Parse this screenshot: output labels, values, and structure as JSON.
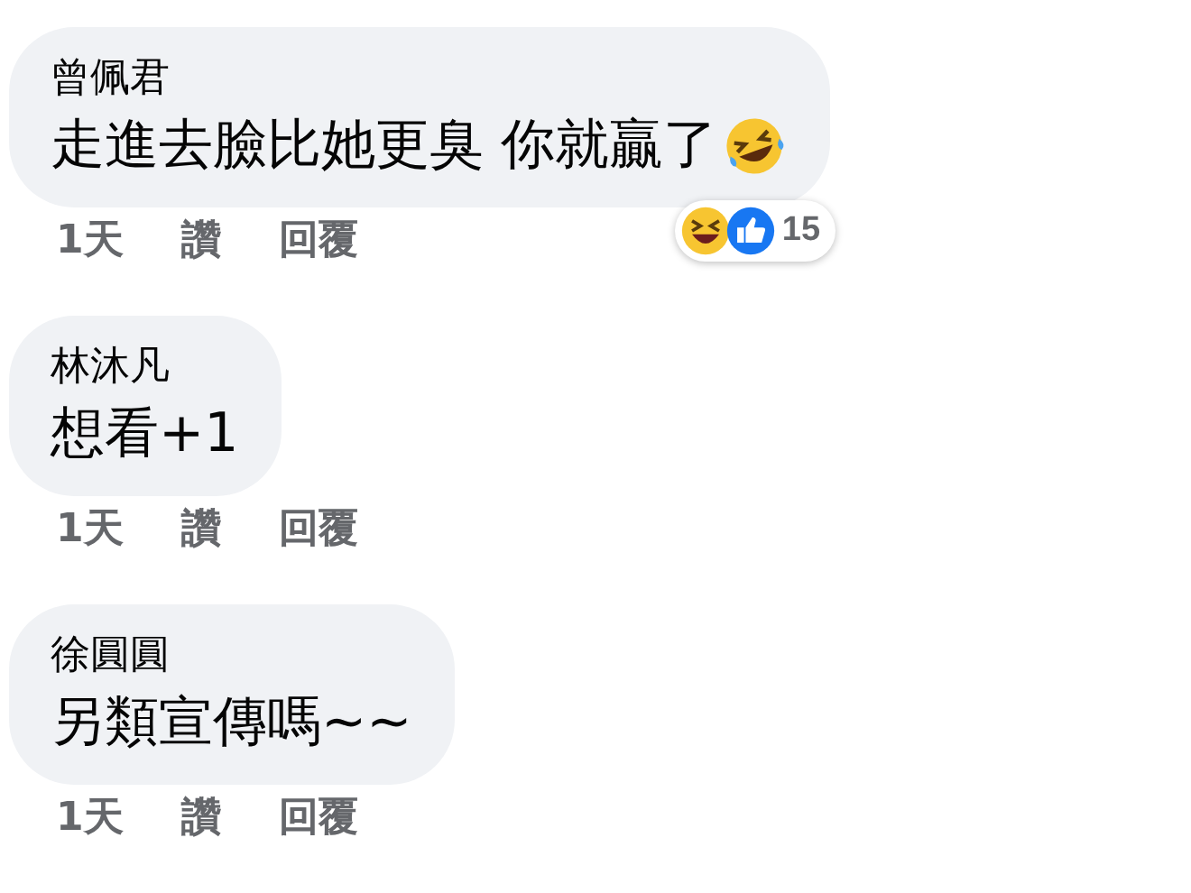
{
  "comments": [
    {
      "author": "曾佩君",
      "text": "走進去臉比她更臭 你就贏了",
      "emoji": true,
      "time": "1天",
      "like": "讚",
      "reply": "回覆",
      "reactions": {
        "count": "15"
      }
    },
    {
      "author": "林沐凡",
      "text": "想看+1",
      "emoji": false,
      "time": "1天",
      "like": "讚",
      "reply": "回覆"
    },
    {
      "author": "徐圓圓",
      "text": "另類宣傳嗎~~",
      "emoji": false,
      "time": "1天",
      "like": "讚",
      "reply": "回覆"
    }
  ]
}
